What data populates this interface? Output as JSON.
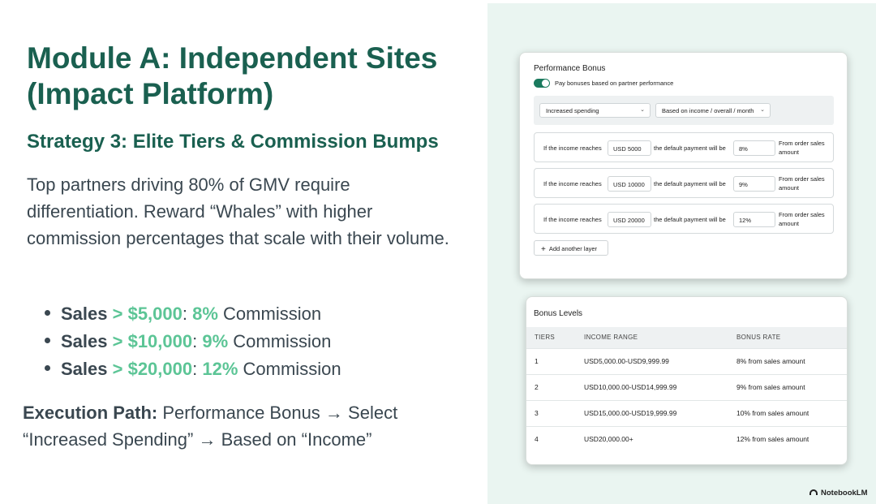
{
  "slide": {
    "title": "Module A: Independent Sites (Impact Platform)",
    "subtitle": "Strategy 3: Elite Tiers & Commission Bumps",
    "intro": "Top partners driving 80% of GMV require differentiation. Reward “Whales” with higher commission percentages that scale with their volume.",
    "bullets": [
      {
        "label": "Sales",
        "threshold": "> $5,000",
        "sep": ":",
        "rate": "8%",
        "suffix": "Commission"
      },
      {
        "label": "Sales",
        "threshold": "> $10,000",
        "sep": ":",
        "rate": "9%",
        "suffix": "Commission"
      },
      {
        "label": "Sales",
        "threshold": "> $20,000",
        "sep": ":",
        "rate": "12%",
        "suffix": "Commission"
      }
    ],
    "execution_label": "Execution Path:",
    "execution_text": "Performance Bonus → Select “Increased Spending” → Based on “Income”"
  },
  "performance_bonus": {
    "title": "Performance Bonus",
    "toggle_label": "Pay bonuses based on partner performance",
    "select_type": "Increased spending",
    "select_basis": "Based on income / overall / month",
    "layers": [
      {
        "prefix": "If the income reaches",
        "amount": "USD 5000",
        "middle": "the default payment will be",
        "rate": "8%",
        "suffix": "From order sales amount"
      },
      {
        "prefix": "If the income reaches",
        "amount": "USD 10000",
        "middle": "the default payment will be",
        "rate": "9%",
        "suffix": "From order sales amount"
      },
      {
        "prefix": "If the income reaches",
        "amount": "USD 20000",
        "middle": "the default payment will be",
        "rate": "12%",
        "suffix": "From order sales amount"
      }
    ],
    "add_layer_label": "Add another layer"
  },
  "bonus_levels": {
    "title": "Bonus Levels",
    "headers": [
      "TIERS",
      "INCOME RANGE",
      "BONUS RATE"
    ],
    "rows": [
      [
        "1",
        "USD5,000.00-USD9,999.99",
        "8% from sales amount"
      ],
      [
        "2",
        "USD10,000.00-USD14,999.99",
        "9% from sales amount"
      ],
      [
        "3",
        "USD15,000.00-USD19,999.99",
        "10% from sales amount"
      ],
      [
        "4",
        "USD20,000.00+",
        "12% from sales amount"
      ]
    ]
  },
  "brand": {
    "logo_text": "NotebookLM",
    "accent_color": "#1a6050",
    "highlight_color": "#5cc596",
    "panel_color": "#eaf5f1"
  }
}
